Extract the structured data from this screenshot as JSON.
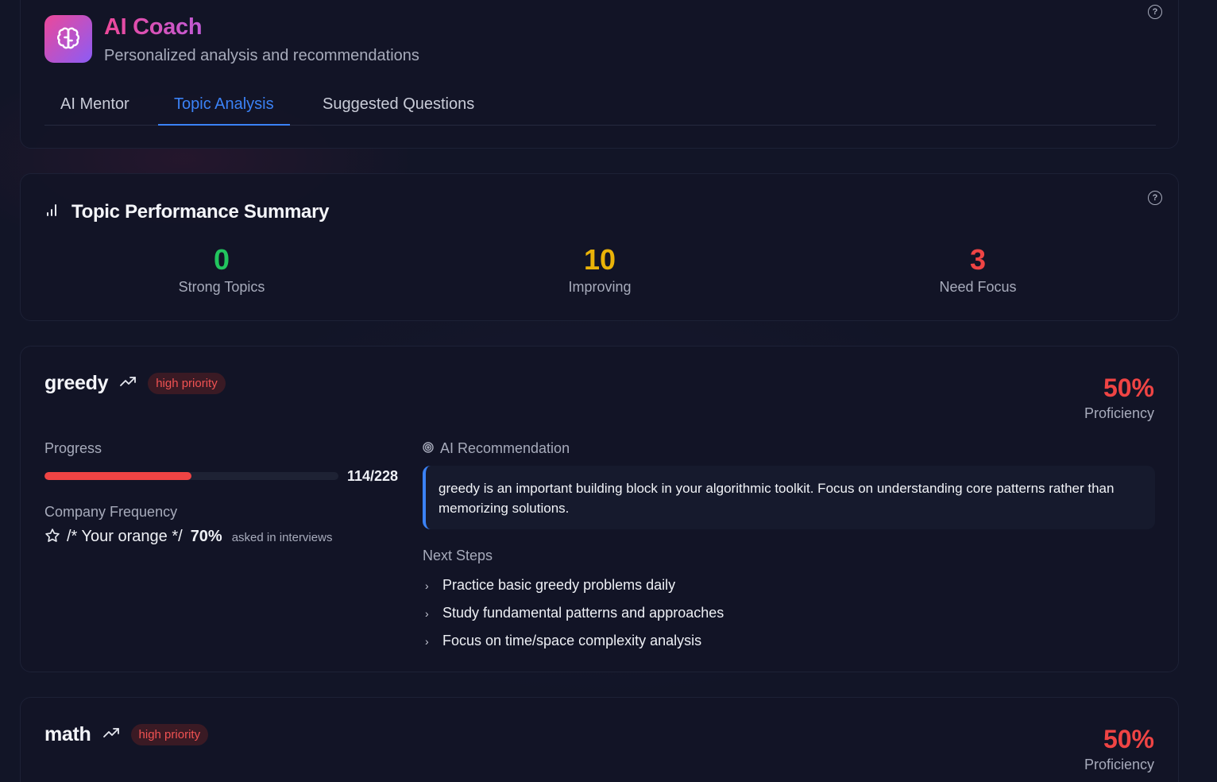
{
  "header": {
    "title": "AI Coach",
    "subtitle": "Personalized analysis and recommendations",
    "tabs": [
      {
        "label": "AI Mentor",
        "active": false
      },
      {
        "label": "Topic Analysis",
        "active": true
      },
      {
        "label": "Suggested Questions",
        "active": false
      }
    ],
    "help_icon": "help-circle-icon",
    "logo_icon": "brain-icon"
  },
  "summary": {
    "title": "Topic Performance Summary",
    "icon": "bar-chart-icon",
    "stats": [
      {
        "value": "0",
        "label": "Strong Topics",
        "color": "#22c55e"
      },
      {
        "value": "10",
        "label": "Improving",
        "color": "#eab308"
      },
      {
        "value": "3",
        "label": "Need Focus",
        "color": "#ef4444"
      }
    ]
  },
  "topics": [
    {
      "name": "greedy",
      "trend_icon": "trending-up-icon",
      "priority": "high priority",
      "proficiency": "50%",
      "proficiency_label": "Proficiency",
      "progress_label": "Progress",
      "progress_solved": 114,
      "progress_total": 228,
      "progress_text": "114/228",
      "frequency_label": "Company Frequency",
      "frequency_company": "/* Your orange */",
      "frequency_pct": "70%",
      "frequency_note": "asked in interviews",
      "recommendation_label": "AI Recommendation",
      "recommendation": "greedy is an important building block in your algorithmic toolkit. Focus on understanding core patterns rather than memorizing solutions.",
      "next_steps_label": "Next Steps",
      "next_steps": [
        "Practice basic greedy problems daily",
        "Study fundamental patterns and approaches",
        "Focus on time/space complexity analysis"
      ]
    },
    {
      "name": "math",
      "trend_icon": "trending-up-icon",
      "priority": "high priority",
      "proficiency": "50%",
      "proficiency_label": "Proficiency"
    }
  ],
  "colors": {
    "accent": "#3b82f6",
    "danger": "#ef4444",
    "brand_gradient_start": "#ec4899",
    "brand_gradient_end": "#8b5cf6"
  }
}
